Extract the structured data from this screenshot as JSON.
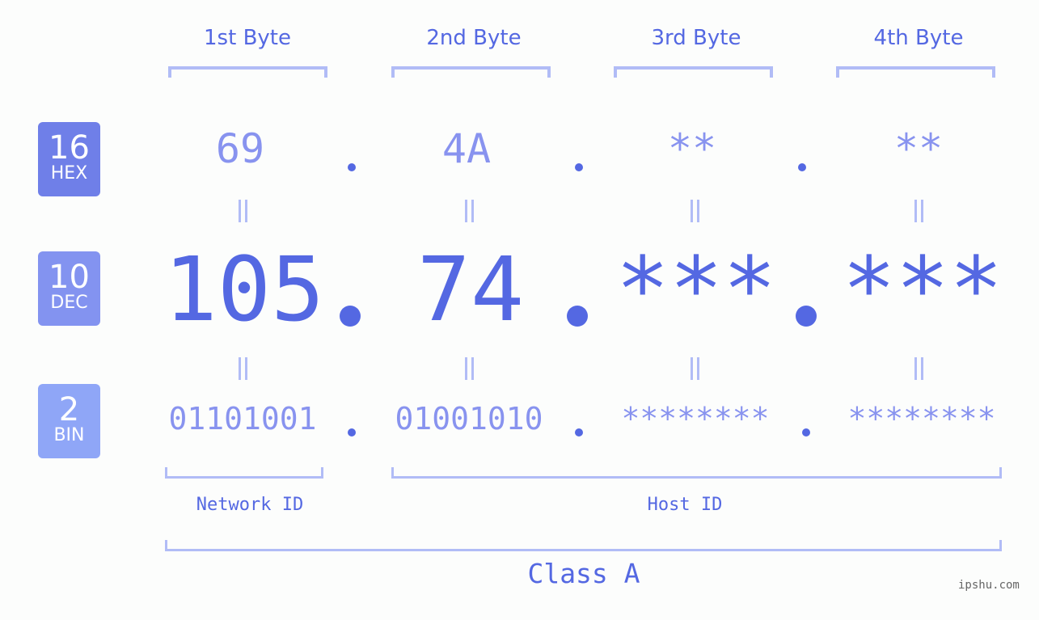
{
  "bytes": [
    {
      "label": "1st Byte",
      "hex": "69",
      "dec": "105",
      "bin": "01101001"
    },
    {
      "label": "2nd Byte",
      "hex": "4A",
      "dec": "74",
      "bin": "01001010"
    },
    {
      "label": "3rd Byte",
      "hex": "**",
      "dec": "***",
      "bin": "********"
    },
    {
      "label": "4th Byte",
      "hex": "**",
      "dec": "***",
      "bin": "********"
    }
  ],
  "badges": {
    "hex": {
      "num": "16",
      "label": "HEX",
      "color": "#6f7fe8"
    },
    "dec": {
      "num": "10",
      "label": "DEC",
      "color": "#8393f0"
    },
    "bin": {
      "num": "2",
      "label": "BIN",
      "color": "#8fa6f7"
    }
  },
  "network_id_label": "Network ID",
  "host_id_label": "Host ID",
  "class_label": "Class A",
  "watermark": "ipshu.com",
  "colors": {
    "accent": "#5468e2",
    "light": "#8893ef",
    "bracket": "#b1bcf6"
  }
}
